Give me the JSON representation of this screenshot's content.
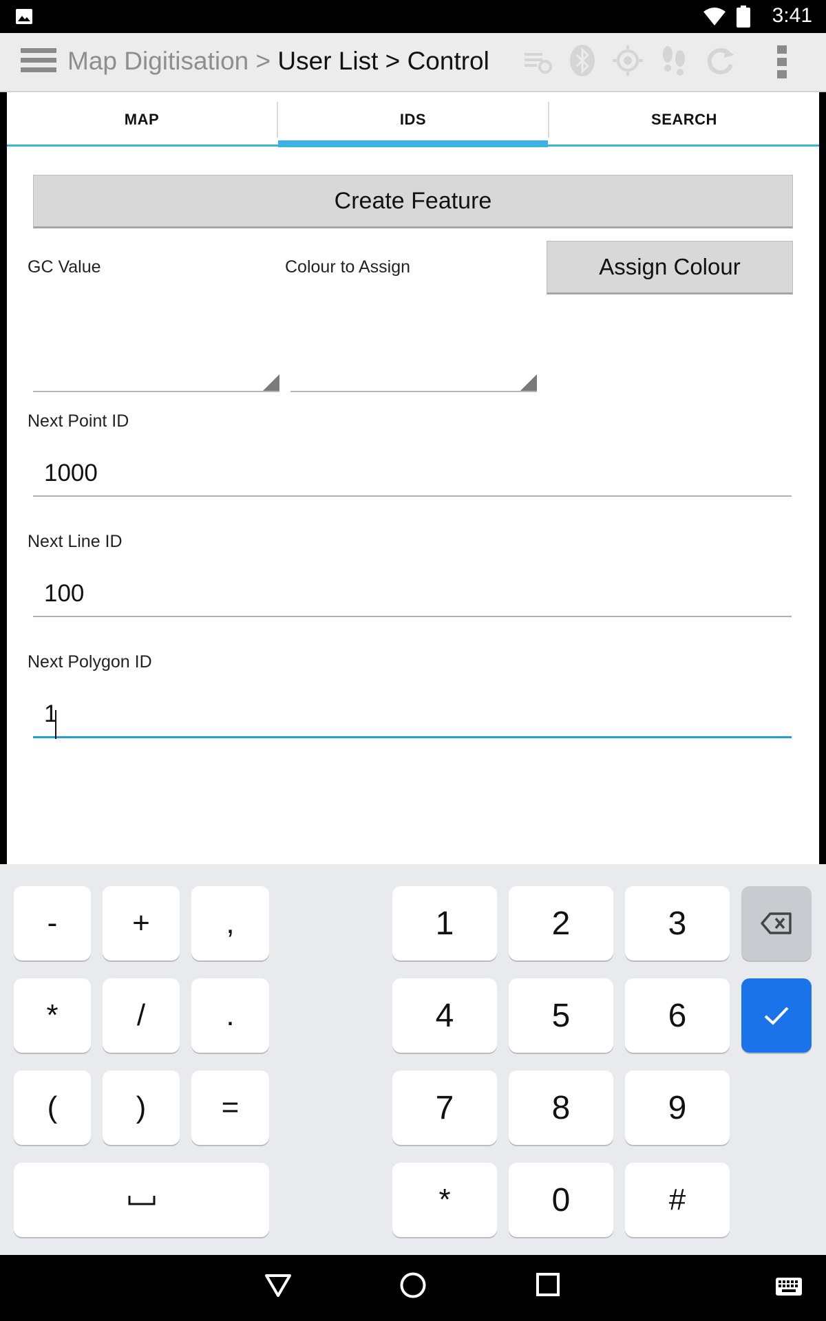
{
  "status_bar": {
    "time": "3:41"
  },
  "action_bar": {
    "breadcrumb_root": "Map Digitisation",
    "breadcrumb_sep1": " > ",
    "breadcrumb_mid": "User List",
    "breadcrumb_sep2": " > ",
    "breadcrumb_current": "Control"
  },
  "tabs": [
    {
      "label": "MAP",
      "active": false
    },
    {
      "label": "IDS",
      "active": true
    },
    {
      "label": "SEARCH",
      "active": false
    }
  ],
  "form": {
    "create_feature_label": "Create Feature",
    "gc_value_label": "GC Value",
    "colour_label": "Colour to Assign",
    "assign_colour_label": "Assign Colour",
    "next_point_label": "Next Point ID",
    "next_point_value": "1000",
    "next_line_label": "Next Line ID",
    "next_line_value": "100",
    "next_polygon_label": "Next Polygon ID",
    "next_polygon_value": "1"
  },
  "keyboard": {
    "minus": "-",
    "plus": "+",
    "comma": ",",
    "asterisk_left": "*",
    "slash": "/",
    "period": ".",
    "paren_open": "(",
    "paren_close": ")",
    "equals": "=",
    "space": "␣",
    "one": "1",
    "two": "2",
    "three": "3",
    "four": "4",
    "five": "5",
    "six": "6",
    "seven": "7",
    "eight": "8",
    "nine": "9",
    "star": "*",
    "zero": "0",
    "hash": "#"
  },
  "colors": {
    "accent": "#3cb2e2",
    "enter_key": "#1a73e8"
  }
}
